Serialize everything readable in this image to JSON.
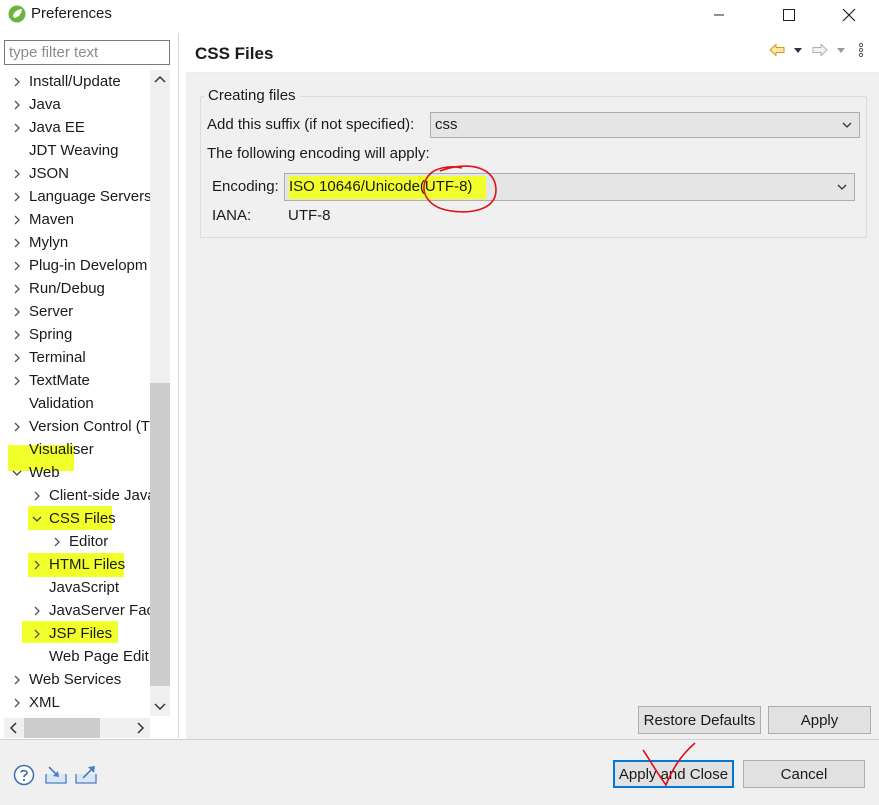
{
  "window": {
    "title": "Preferences"
  },
  "filter": {
    "placeholder": "type filter text",
    "value": ""
  },
  "tree": [
    {
      "label": "Install/Update",
      "expander": "collapsed",
      "depth": 0
    },
    {
      "label": "Java",
      "expander": "collapsed",
      "depth": 0
    },
    {
      "label": "Java EE",
      "expander": "collapsed",
      "depth": 0
    },
    {
      "label": "JDT Weaving",
      "expander": "none",
      "depth": 0
    },
    {
      "label": "JSON",
      "expander": "collapsed",
      "depth": 0
    },
    {
      "label": "Language Servers",
      "expander": "collapsed",
      "depth": 0
    },
    {
      "label": "Maven",
      "expander": "collapsed",
      "depth": 0
    },
    {
      "label": "Mylyn",
      "expander": "collapsed",
      "depth": 0
    },
    {
      "label": "Plug-in Developm",
      "expander": "collapsed",
      "depth": 0
    },
    {
      "label": "Run/Debug",
      "expander": "collapsed",
      "depth": 0
    },
    {
      "label": "Server",
      "expander": "collapsed",
      "depth": 0
    },
    {
      "label": "Spring",
      "expander": "collapsed",
      "depth": 0
    },
    {
      "label": "Terminal",
      "expander": "collapsed",
      "depth": 0
    },
    {
      "label": "TextMate",
      "expander": "collapsed",
      "depth": 0
    },
    {
      "label": "Validation",
      "expander": "none",
      "depth": 0
    },
    {
      "label": "Version Control (T",
      "expander": "collapsed",
      "depth": 0
    },
    {
      "label": "Visualiser",
      "expander": "none",
      "depth": 0
    },
    {
      "label": "Web",
      "expander": "expanded",
      "depth": 0
    },
    {
      "label": "Client-side Java",
      "expander": "collapsed",
      "depth": 1
    },
    {
      "label": "CSS Files",
      "expander": "expanded",
      "depth": 1
    },
    {
      "label": "Editor",
      "expander": "collapsed",
      "depth": 2
    },
    {
      "label": "HTML Files",
      "expander": "collapsed",
      "depth": 1
    },
    {
      "label": "JavaScript",
      "expander": "none",
      "depth": 1
    },
    {
      "label": "JavaServer Face",
      "expander": "collapsed",
      "depth": 1
    },
    {
      "label": "JSP Files",
      "expander": "collapsed",
      "depth": 1
    },
    {
      "label": "Web Page Edit",
      "expander": "none",
      "depth": 1
    },
    {
      "label": "Web Services",
      "expander": "collapsed",
      "depth": 0
    },
    {
      "label": "XML",
      "expander": "collapsed",
      "depth": 0
    }
  ],
  "page": {
    "title": "CSS Files",
    "group_title": "Creating files",
    "suffix_label": "Add this suffix (if not specified):",
    "suffix_value": "css",
    "encoding_note": "The following encoding will apply:",
    "encoding_label": "Encoding:",
    "encoding_value": "ISO 10646/Unicode(UTF-8)",
    "iana_label": "IANA:",
    "iana_value": "UTF-8"
  },
  "buttons": {
    "restore_defaults": "Restore Defaults",
    "apply": "Apply",
    "apply_and_close": "Apply and Close",
    "cancel": "Cancel"
  },
  "colors": {
    "highlight": "#f1ff2b",
    "annotation_red": "#e0101a",
    "default_button_border": "#0078d7"
  }
}
